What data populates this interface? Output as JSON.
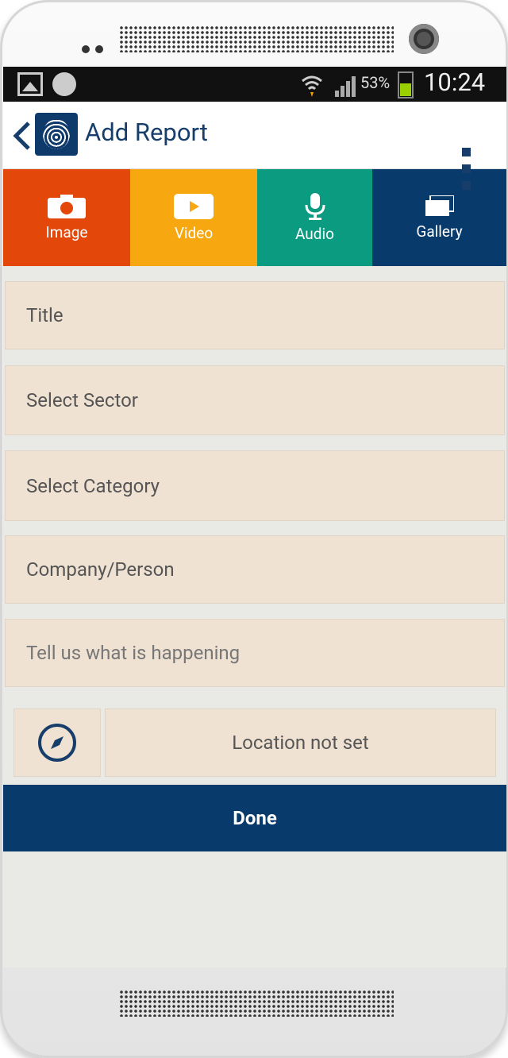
{
  "status_bar": {
    "battery": "53%",
    "time": "10:24"
  },
  "app_bar": {
    "title": "Add Report"
  },
  "media_buttons": [
    {
      "label": "Image",
      "icon": "camera-icon",
      "color": "#e4470a"
    },
    {
      "label": "Video",
      "icon": "play-icon",
      "color": "#f7a70f"
    },
    {
      "label": "Audio",
      "icon": "microphone-icon",
      "color": "#0a9b80"
    },
    {
      "label": "Gallery",
      "icon": "gallery-icon",
      "color": "#083b6c"
    }
  ],
  "form": {
    "title_placeholder": "Title",
    "sector_placeholder": "Select Sector",
    "category_placeholder": "Select Category",
    "company_placeholder": "Company/Person",
    "description_placeholder": "Tell us what is happening",
    "location_status": "Location not set",
    "done_label": "Done"
  },
  "colors": {
    "primary": "#083b6c",
    "field_bg": "#efe2d3",
    "screen_bg": "#e9e9e5"
  }
}
